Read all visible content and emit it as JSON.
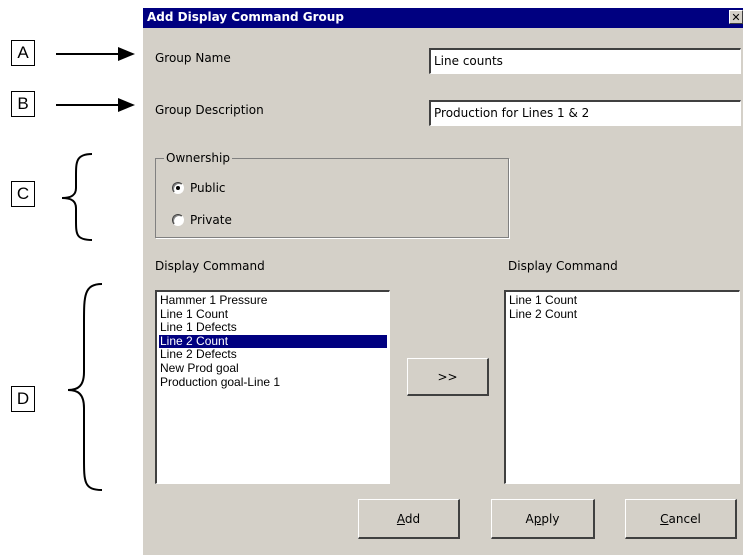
{
  "callouts": [
    {
      "letter": "A"
    },
    {
      "letter": "B"
    },
    {
      "letter": "C"
    },
    {
      "letter": "D"
    }
  ],
  "dialog": {
    "title": "Add Display Command Group",
    "close_glyph": "✕",
    "group_name": {
      "label": "Group Name",
      "value": "Line counts"
    },
    "group_description": {
      "label": "Group Description",
      "value": "Production for Lines 1 & 2"
    },
    "ownership": {
      "legend": "Ownership",
      "options": [
        {
          "label": "Public",
          "selected": true
        },
        {
          "label": "Private",
          "selected": false
        }
      ]
    },
    "available": {
      "label": "Display Command",
      "items": [
        "Hammer 1 Pressure",
        "Line 1 Count",
        "Line 1 Defects",
        "Line 2 Count",
        "Line 2 Defects",
        "New Prod goal",
        "Production goal-Line 1"
      ],
      "selected_index": 3
    },
    "move_button": ">>",
    "chosen": {
      "label": "Display Command",
      "items": [
        "Line 1 Count",
        "Line 2 Count"
      ]
    },
    "buttons": {
      "add": {
        "mnemonic": "A",
        "rest": "dd"
      },
      "apply": {
        "before": "A",
        "mnemonic": "p",
        "rest": "ply"
      },
      "cancel": {
        "mnemonic": "C",
        "rest": "ancel"
      }
    }
  }
}
